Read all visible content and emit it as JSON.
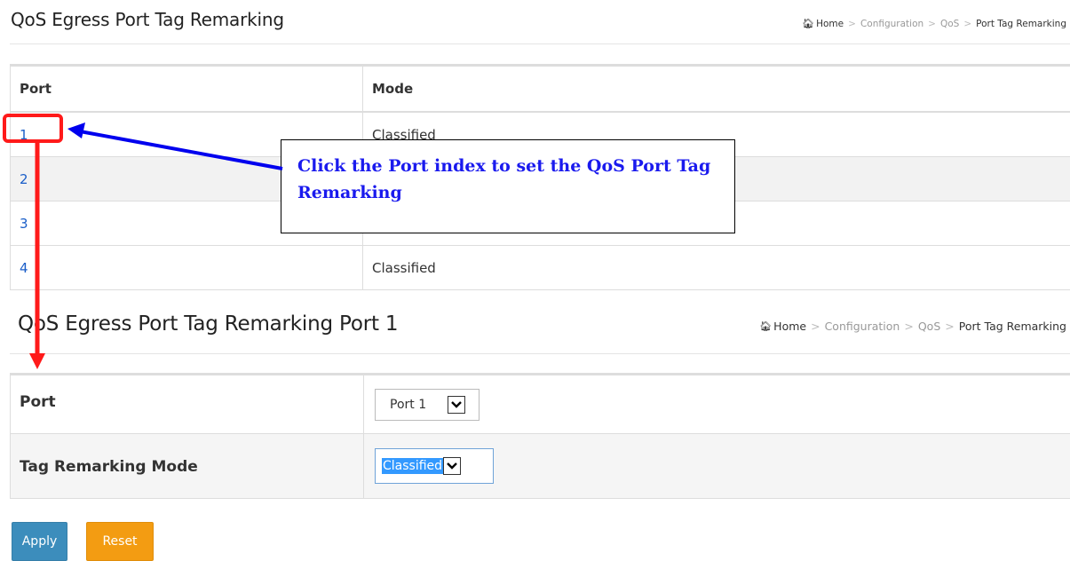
{
  "section1": {
    "title": "QoS Egress Port Tag Remarking",
    "breadcrumb": {
      "home_icon": "home-icon",
      "items": [
        "Home",
        "Configuration",
        "QoS",
        "Port Tag Remarking"
      ],
      "separator": ">"
    },
    "table": {
      "headers": [
        "Port",
        "Mode"
      ],
      "rows": [
        {
          "port": "1",
          "mode": "Classified"
        },
        {
          "port": "2",
          "mode": ""
        },
        {
          "port": "3",
          "mode": ""
        },
        {
          "port": "4",
          "mode": "Classified"
        }
      ]
    }
  },
  "callout": {
    "text": "Click the Port index to set the QoS Port Tag Remarking",
    "color": "#1a1aee"
  },
  "section2": {
    "title": "QoS Egress Port Tag Remarking  Port 1",
    "breadcrumb": {
      "home_icon": "home-icon",
      "items": [
        "Home",
        "Configuration",
        "QoS",
        "Port Tag Remarking"
      ],
      "separator": ">"
    },
    "form": {
      "port_label": "Port",
      "port_value": "Port 1",
      "mode_label": "Tag Remarking Mode",
      "mode_value": "Classified"
    }
  },
  "buttons": {
    "apply": "Apply",
    "reset": "Reset"
  },
  "colors": {
    "apply": "#3c8dbc",
    "reset": "#f39c12",
    "link": "#1a5ec8",
    "highlight": "#ff1a1a",
    "arrow_blue": "#0000ee"
  }
}
